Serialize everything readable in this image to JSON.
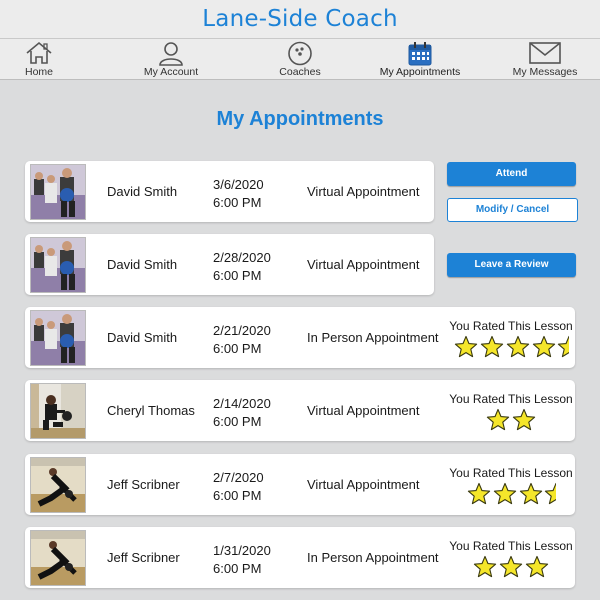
{
  "app": {
    "title": "Lane-Side Coach"
  },
  "tabs": [
    {
      "label": "Home",
      "icon": "home-icon"
    },
    {
      "label": "My Account",
      "icon": "account-icon"
    },
    {
      "label": "Coaches",
      "icon": "bowling-ball-icon"
    },
    {
      "label": "My Appointments",
      "icon": "calendar-icon",
      "active": true
    },
    {
      "label": "My Messages",
      "icon": "envelope-icon"
    }
  ],
  "page": {
    "title": "My Appointments"
  },
  "appointments": [
    {
      "coach": "David Smith",
      "date": "3/6/2020",
      "time": "6:00 PM",
      "type": "Virtual Appointment",
      "actions": [
        "Attend",
        "Modify / Cancel"
      ]
    },
    {
      "coach": "David Smith",
      "date": "2/28/2020",
      "time": "6:00 PM",
      "type": "Virtual Appointment",
      "actions": [
        "Leave a Review"
      ]
    },
    {
      "coach": "David Smith",
      "date": "2/21/2020",
      "time": "6:00 PM",
      "type": "In Person Appointment",
      "rating_label": "You Rated This Lesson",
      "rating": 4.5
    },
    {
      "coach": "Cheryl Thomas",
      "date": "2/14/2020",
      "time": "6:00 PM",
      "type": "Virtual Appointment",
      "rating_label": "You Rated This Lesson",
      "rating": 2
    },
    {
      "coach": "Jeff Scribner",
      "date": "2/7/2020",
      "time": "6:00 PM",
      "type": "Virtual Appointment",
      "rating_label": "You Rated This Lesson",
      "rating": 3.5
    },
    {
      "coach": "Jeff Scribner",
      "date": "1/31/2020",
      "time": "6:00 PM",
      "type": "In Person Appointment",
      "rating_label": "You Rated This Lesson",
      "rating": 3
    }
  ],
  "colors": {
    "accent": "#1d82d6",
    "star_fill": "#f5e62a",
    "star_stroke": "#3a3a10",
    "background": "#dbdcdd"
  }
}
